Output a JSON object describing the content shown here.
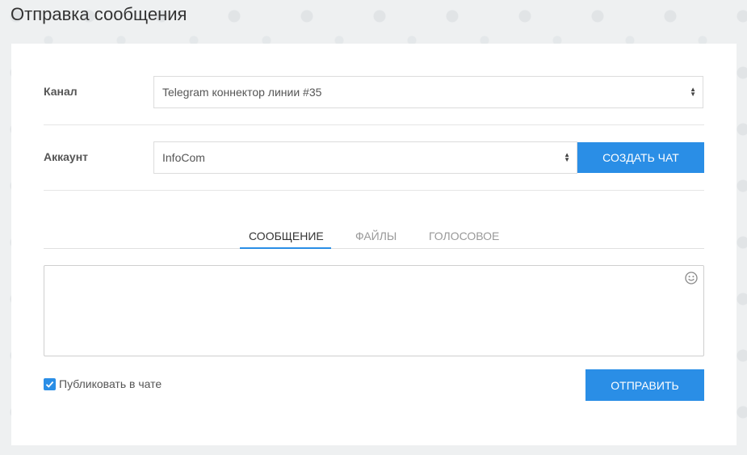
{
  "page": {
    "title": "Отправка сообщения"
  },
  "channel": {
    "label": "Канал",
    "value": "Telegram коннектор линии #35"
  },
  "account": {
    "label": "Аккаунт",
    "value": "InfoCom"
  },
  "create_chat_label": "СОЗДАТЬ ЧАТ",
  "tabs": [
    {
      "label": "СООБЩЕНИЕ",
      "active": true
    },
    {
      "label": "ФАЙЛЫ",
      "active": false
    },
    {
      "label": "ГОЛОСОВОЕ",
      "active": false
    }
  ],
  "message": {
    "value": ""
  },
  "publish": {
    "label": "Публиковать в чате",
    "checked": true
  },
  "send_label": "ОТПРАВИТЬ",
  "colors": {
    "accent": "#2a8ee6",
    "background": "#eef0f1"
  }
}
